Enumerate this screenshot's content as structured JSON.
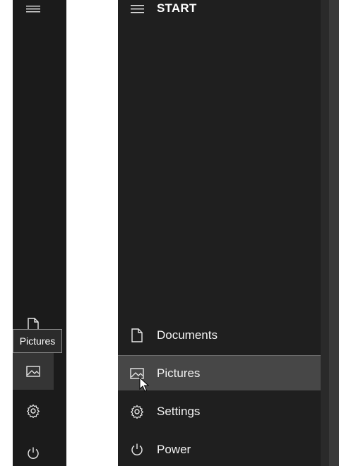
{
  "tooltip": {
    "text": "Pictures"
  },
  "start_menu": {
    "title": "START",
    "items": [
      {
        "label": "Documents",
        "icon": "document-icon"
      },
      {
        "label": "Pictures",
        "icon": "pictures-icon"
      },
      {
        "label": "Settings",
        "icon": "gear-icon"
      },
      {
        "label": "Power",
        "icon": "power-icon"
      }
    ]
  },
  "colors": {
    "rail_bg": "#1b1b1b",
    "panel_bg": "#1f1f1f",
    "hover_bg": "#474747",
    "text": "#f2f2f2"
  }
}
